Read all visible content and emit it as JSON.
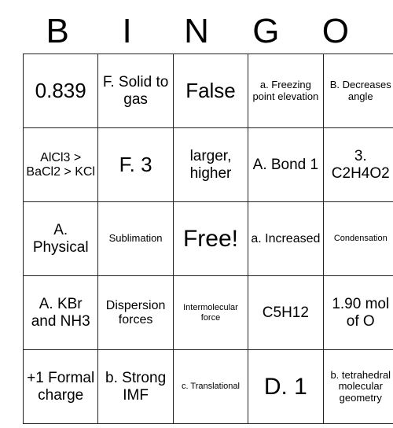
{
  "card": {
    "title": "BINGO",
    "header_letters": [
      "B",
      "I",
      "N",
      "G",
      "O"
    ],
    "free_space": "Free!",
    "border_color": "#222222",
    "background_color": "#ffffff",
    "text_color": "#000000"
  },
  "grid": {
    "rows": 5,
    "columns": 5,
    "cells": [
      [
        {
          "text": "0.839",
          "size": "fs-lg"
        },
        {
          "text": "F. Solid to gas",
          "size": "fs-md"
        },
        {
          "text": "False",
          "size": "fs-lg"
        },
        {
          "text": "a. Freezing point elevation",
          "size": "fs-xs"
        },
        {
          "text": "B. Decreases angle",
          "size": "fs-xs"
        }
      ],
      [
        {
          "text": "AlCl3 > BaCl2 > KCl",
          "size": "fs-sm"
        },
        {
          "text": "F. 3",
          "size": "fs-lg"
        },
        {
          "text": "larger, higher",
          "size": "fs-md"
        },
        {
          "text": "A. Bond 1",
          "size": "fs-md"
        },
        {
          "text": "3. C2H4O2",
          "size": "fs-md"
        }
      ],
      [
        {
          "text": "A. Physical",
          "size": "fs-md"
        },
        {
          "text": "Sublimation",
          "size": "fs-xs"
        },
        {
          "text": "Free!",
          "size": "fs-xl"
        },
        {
          "text": "a. Increased",
          "size": "fs-sm"
        },
        {
          "text": "Condensation",
          "size": "fs-xxs"
        }
      ],
      [
        {
          "text": "A. KBr and NH3",
          "size": "fs-md"
        },
        {
          "text": "Dispersion forces",
          "size": "fs-sm"
        },
        {
          "text": "Intermolecular force",
          "size": "fs-xxs"
        },
        {
          "text": "C5H12",
          "size": "fs-md"
        },
        {
          "text": "1.90 mol of O",
          "size": "fs-md"
        }
      ],
      [
        {
          "text": "+1 Formal charge",
          "size": "fs-md"
        },
        {
          "text": "b. Strong IMF",
          "size": "fs-md"
        },
        {
          "text": "c. Translational",
          "size": "fs-xxs"
        },
        {
          "text": "D. 1",
          "size": "fs-xl"
        },
        {
          "text": "b. tetrahedral molecular geometry",
          "size": "fs-xs"
        }
      ]
    ]
  }
}
